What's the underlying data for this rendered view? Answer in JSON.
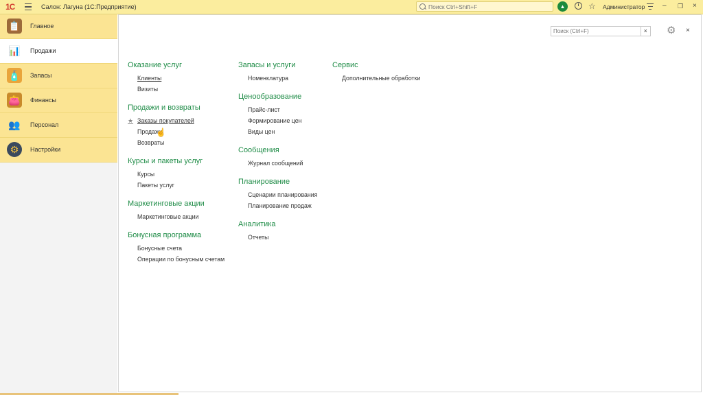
{
  "titlebar": {
    "logo": "1С",
    "title": "Салон: Лагуна  (1С:Предприятие)",
    "search_placeholder": "Поиск Ctrl+Shift+F",
    "user": "Администратор",
    "minimize": "–",
    "restore": "❐",
    "close": "×"
  },
  "sidebar": {
    "items": [
      {
        "label": "Главное",
        "icon": "clipboard-icon"
      },
      {
        "label": "Продажи",
        "icon": "sales-chart-icon",
        "active": true
      },
      {
        "label": "Запасы",
        "icon": "products-icon"
      },
      {
        "label": "Финансы",
        "icon": "wallet-icon"
      },
      {
        "label": "Персонал",
        "icon": "staff-icon"
      },
      {
        "label": "Настройки",
        "icon": "gear-icon"
      }
    ]
  },
  "main": {
    "search_placeholder": "Поиск (Ctrl+F)",
    "clear": "×",
    "close": "×",
    "columns": [
      [
        {
          "title": "Оказание услуг",
          "links": [
            "Клиенты",
            "Визиты"
          ]
        },
        {
          "title": "Продажи и возвраты",
          "links": [
            "Заказы покупателей",
            "Продажи",
            "Возвраты"
          ]
        },
        {
          "title": "Курсы и пакеты услуг",
          "links": [
            "Курсы",
            "Пакеты услуг"
          ]
        },
        {
          "title": "Маркетинговые акции",
          "links": [
            "Маркетинговые акции"
          ]
        },
        {
          "title": "Бонусная программа",
          "links": [
            "Бонусные счета",
            "Операции по бонусным счетам"
          ]
        }
      ],
      [
        {
          "title": "Запасы и услуги",
          "links": [
            "Номенклатура"
          ]
        },
        {
          "title": "Ценообразование",
          "links": [
            "Прайс-лист",
            "Формирование цен",
            "Виды цен"
          ]
        },
        {
          "title": "Сообщения",
          "links": [
            "Журнал сообщений"
          ]
        },
        {
          "title": "Планирование",
          "links": [
            "Сценарии планирования",
            "Планирование продаж"
          ]
        },
        {
          "title": "Аналитика",
          "links": [
            "Отчеты"
          ]
        }
      ],
      [
        {
          "title": "Сервис",
          "links": [
            "Дополнительные обработки"
          ]
        }
      ]
    ]
  },
  "colors": {
    "titlebar": "#fbed9e",
    "sidebar": "#fbe493",
    "group_title": "#1f8c47",
    "notification": "#1d8a3c"
  }
}
